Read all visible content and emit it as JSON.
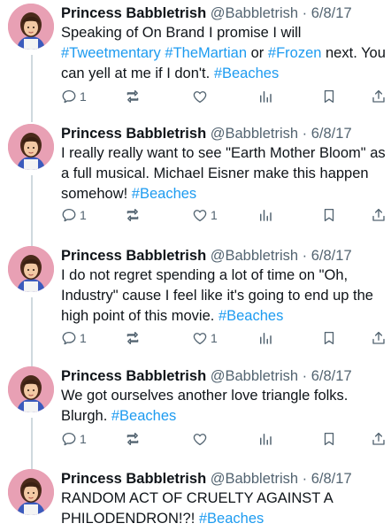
{
  "tweets": [
    {
      "name": "Princess Babbletrish",
      "handle": "@Babbletrish",
      "sep": "·",
      "date": "6/8/17",
      "text": [
        {
          "t": "Speaking of On Brand I promise I will "
        },
        {
          "t": "#Tweetmentary",
          "link": true
        },
        {
          "t": " "
        },
        {
          "t": "#TheMartian",
          "link": true
        },
        {
          "t": " or "
        },
        {
          "t": "#Frozen",
          "link": true
        },
        {
          "t": " next. You can yell at me if I don't. "
        },
        {
          "t": "#Beaches",
          "link": true
        }
      ],
      "reply_count": "1",
      "retweet_count": "",
      "like_count": ""
    },
    {
      "name": "Princess Babbletrish",
      "handle": "@Babbletrish",
      "sep": "·",
      "date": "6/8/17",
      "text": [
        {
          "t": "I really really want to see \"Earth Mother Bloom\" as a full musical. Michael Eisner make this happen somehow!  "
        },
        {
          "t": "#Beaches",
          "link": true
        }
      ],
      "reply_count": "1",
      "retweet_count": "",
      "like_count": "1"
    },
    {
      "name": "Princess Babbletrish",
      "handle": "@Babbletrish",
      "sep": "·",
      "date": "6/8/17",
      "text": [
        {
          "t": "I do not regret spending a lot of time on \"Oh, Industry\" cause I feel like it's going to end up the high point of this movie. "
        },
        {
          "t": "#Beaches",
          "link": true
        }
      ],
      "reply_count": "1",
      "retweet_count": "",
      "like_count": "1"
    },
    {
      "name": "Princess Babbletrish",
      "handle": "@Babbletrish",
      "sep": "·",
      "date": "6/8/17",
      "text": [
        {
          "t": "We got ourselves another love triangle folks. Blurgh.  "
        },
        {
          "t": "#Beaches",
          "link": true
        }
      ],
      "reply_count": "1",
      "retweet_count": "",
      "like_count": ""
    },
    {
      "name": "Princess Babbletrish",
      "handle": "@Babbletrish",
      "sep": "·",
      "date": "6/8/17",
      "text": [
        {
          "t": "RANDOM ACT OF CRUELTY AGAINST A PHILODENDRON!?!  "
        },
        {
          "t": "#Beaches",
          "link": true
        }
      ],
      "reply_count": "",
      "retweet_count": "",
      "like_count": ""
    }
  ],
  "colors": {
    "link": "#1d9bf0",
    "muted": "#536471",
    "text": "#0f1419",
    "thread_line": "#cfd9de",
    "avatar_bg": "#e8a0b4"
  },
  "icons": [
    "reply-icon",
    "retweet-icon",
    "like-icon",
    "views-icon",
    "bookmark-icon",
    "share-icon"
  ]
}
